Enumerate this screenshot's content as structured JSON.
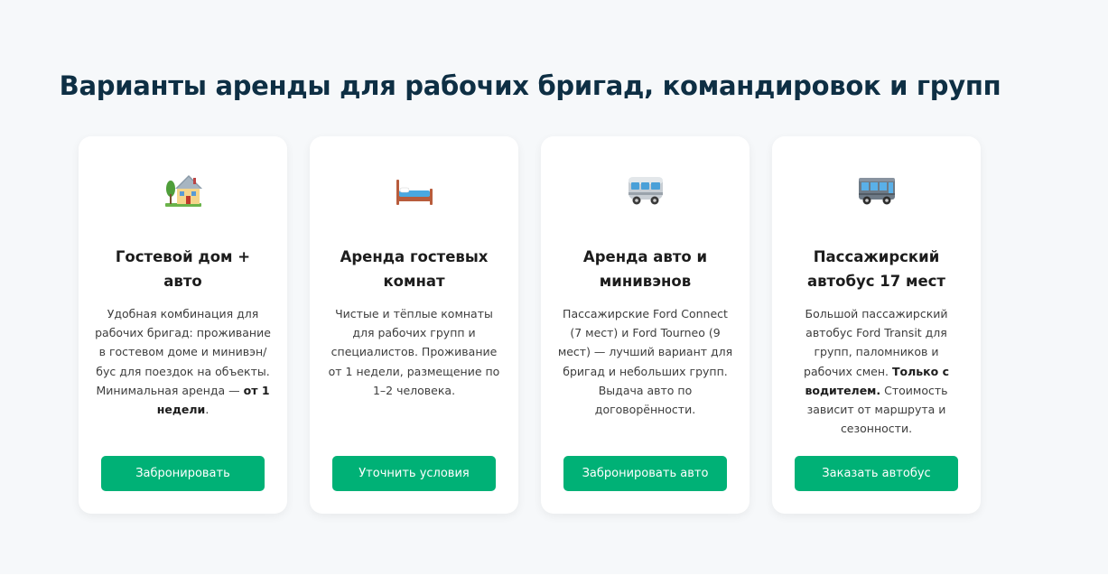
{
  "section": {
    "title": "Варианты аренды для рабочих бригад, командировок и групп"
  },
  "cards": [
    {
      "icon": "house-with-garden-icon",
      "title": "Гостевой дом + авто",
      "desc_parts": [
        {
          "text": "Удобная комбинация для рабочих бригад: проживание в гостевом доме и минивэн/бус для поездок на объекты. Минимальная аренда — ",
          "bold": false
        },
        {
          "text": "от 1 недели",
          "bold": true
        },
        {
          "text": ".",
          "bold": false
        }
      ],
      "button": "Забронировать"
    },
    {
      "icon": "bed-icon",
      "title": "Аренда гостевых комнат",
      "desc_parts": [
        {
          "text": "Чистые и тёплые комнаты для рабочих групп и специалистов. Проживание от 1 недели, размещение по 1–2 человека.",
          "bold": false
        }
      ],
      "button": "Уточнить условия"
    },
    {
      "icon": "minibus-icon",
      "title": "Аренда авто и минивэнов",
      "desc_parts": [
        {
          "text": "Пассажирские Ford Connect (7 мест) и Ford Tourneo (9 мест) — лучший вариант для бригад и небольших групп. Выдача авто по договорённости.",
          "bold": false
        }
      ],
      "button": "Забронировать авто"
    },
    {
      "icon": "bus-icon",
      "title": "Пассажирский автобус 17 мест",
      "desc_parts": [
        {
          "text": "Большой пассажирский автобус Ford Transit для групп, паломников и рабочих смен. ",
          "bold": false
        },
        {
          "text": "Только с водителем.",
          "bold": true
        },
        {
          "text": " Стоимость зависит от маршрута и сезонности.",
          "bold": false
        }
      ],
      "button": "Заказать автобус"
    }
  ]
}
